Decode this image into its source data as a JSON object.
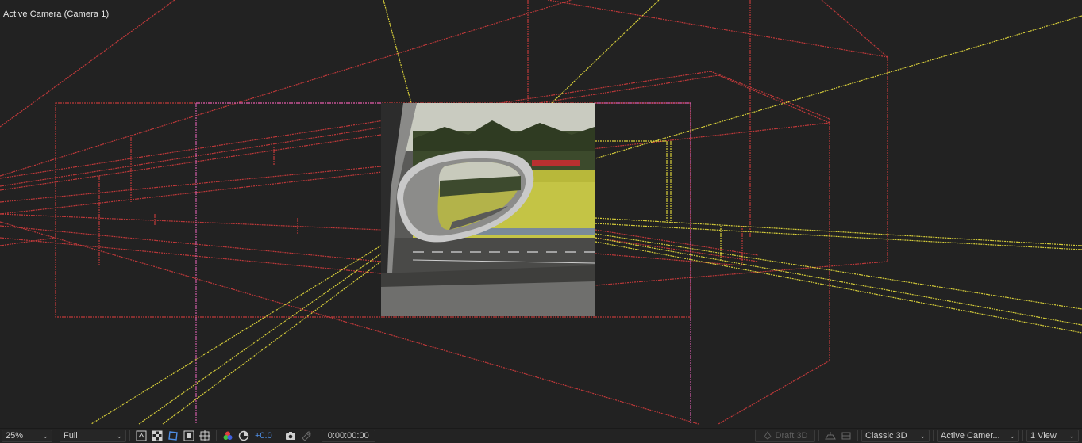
{
  "viewer": {
    "view_label": "Active Camera (Camera 1)"
  },
  "toolbar": {
    "zoom": "25%",
    "resolution": "Full",
    "exposure_value": "+0.0",
    "timecode": "0:00:00:00",
    "draft3d_label": "Draft 3D",
    "renderer": "Classic 3D",
    "camera_view": "Active Camer...",
    "views": "1 View"
  },
  "colors": {
    "wire_red": "#c0393a",
    "wire_yellow": "#d8cf3a",
    "wire_magenta": "#d05aa8",
    "accent_blue": "#4f8fe6",
    "background": "#222222"
  },
  "icons": {
    "snapshot": "camera-icon",
    "show_snapshot": "show-snapshot-icon",
    "channels": "rgb-channels-icon",
    "color_management": "color-management-icon",
    "region_of_interest": "region-of-interest-icon",
    "transparency_grid": "transparency-grid-icon",
    "fast_previews": "fast-previews-icon",
    "mask_visibility": "mask-visibility-icon",
    "guides": "guides-icon",
    "ground_plane": "ground-plane-icon"
  }
}
